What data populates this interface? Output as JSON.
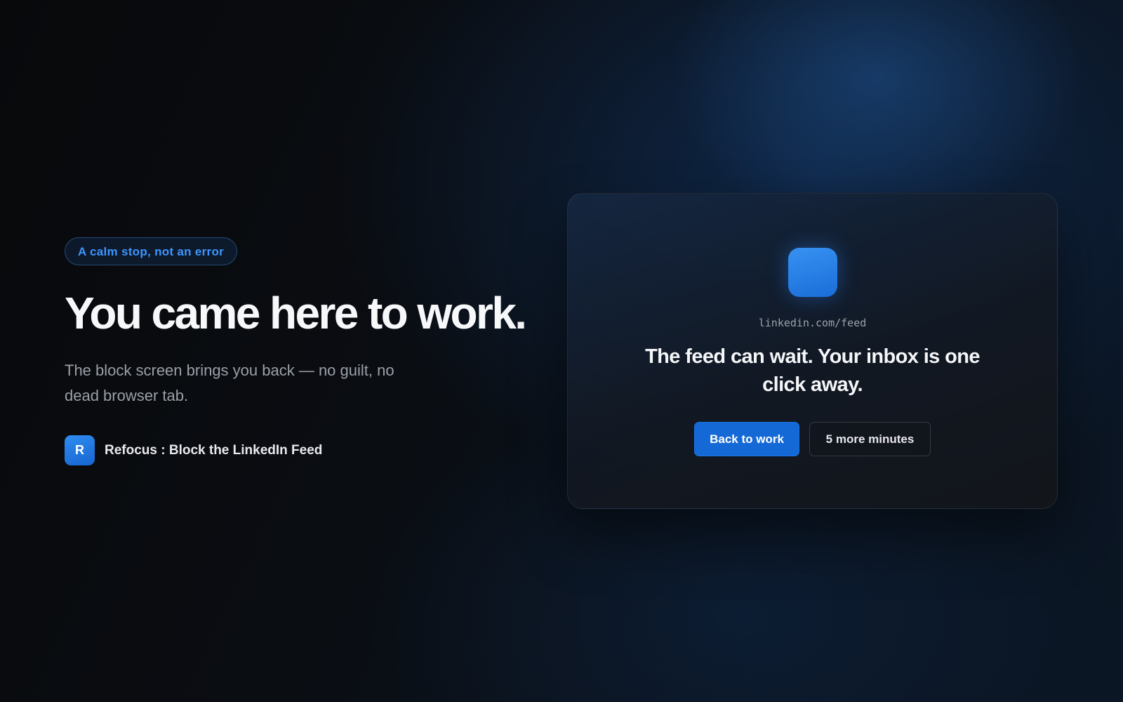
{
  "hero": {
    "badge": "A calm stop, not an error",
    "headline": "You came here to work.",
    "subtext": "The block screen brings you back — no guilt, no dead browser tab."
  },
  "brand": {
    "logo_letter": "R",
    "name": "Refocus : Block the LinkedIn Feed"
  },
  "card": {
    "url": "linkedin.com/feed",
    "message": "The feed can wait. Your inbox is one click away.",
    "primary_button": "Back to work",
    "secondary_button": "5 more minutes"
  },
  "colors": {
    "accent": "#1569d6",
    "badge_text": "#3e95ff",
    "background": "#0a0d12"
  }
}
